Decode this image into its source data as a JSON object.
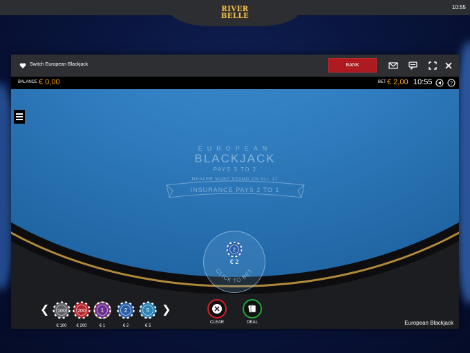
{
  "site": {
    "logo_line1": "RIVER",
    "logo_line2": "BELLE",
    "clock": "10:55"
  },
  "game_window": {
    "title": "Switch European Blackjack",
    "bank_label": "BANK",
    "header_icons": [
      "envelope-icon",
      "chat-icon",
      "fullscreen-icon",
      "close-icon"
    ]
  },
  "status_bar": {
    "balance_label": "BALANCE",
    "balance_value": "€ 0,00",
    "bet_label": "BET",
    "bet_value": "€ 2,00",
    "clock": "10:55",
    "icons": [
      "sound-icon",
      "help-icon"
    ]
  },
  "table": {
    "line1": "EUROPEAN",
    "line2": "BLACKJACK",
    "line3": "PAYS 3 TO 2",
    "line4": "DEALER MUST STAND ON ALL 17",
    "line5": "INSURANCE PAYS 2 TO 1",
    "bet_spot_label": "CLICK TO BET",
    "placed_chip_value": "2",
    "placed_amount": "€ 2"
  },
  "chips": [
    {
      "value": "100",
      "label": "€ 100",
      "color": "#5b5d63",
      "selected": false
    },
    {
      "value": "200",
      "label": "€ 200",
      "color": "#b3262c",
      "selected": false
    },
    {
      "value": "1",
      "label": "€ 1",
      "color": "#6a2e8c",
      "selected": true
    },
    {
      "value": "2",
      "label": "€ 2",
      "color": "#2a5fa8",
      "selected": false
    },
    {
      "value": "5",
      "label": "€ 5",
      "color": "#2b82b3",
      "selected": false
    }
  ],
  "nav": {
    "prev": "❮",
    "next": "❯"
  },
  "actions": {
    "clear_label": "CLEAR",
    "deal_label": "DEAL",
    "clear_color": "#d41f26",
    "deal_color": "#23a83a"
  },
  "footer": {
    "game_name": "European Blackjack"
  },
  "colors": {
    "accent_orange": "#f5a11b",
    "bank_red": "#ad1a1f",
    "felt_blue": "#2f7bbd"
  }
}
